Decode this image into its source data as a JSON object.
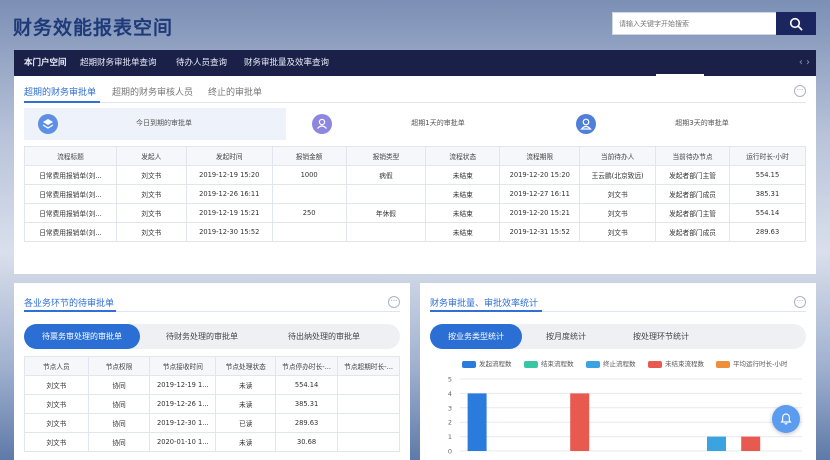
{
  "header": {
    "logo": "财务效能报表空间",
    "search_placeholder": "请输入关键字开始搜索",
    "search_icon": "search-icon"
  },
  "nav": {
    "items": [
      "本门户空间",
      "超期财务审批单查询",
      "待办人员查询",
      "财务审批量及效率查询"
    ],
    "active": 0,
    "arrows": "‹  ›"
  },
  "top": {
    "tabs": [
      "超期的财务审批单",
      "超期的财务审核人员",
      "终止的审批单"
    ],
    "active_tab": 0,
    "more": "···",
    "cards": [
      {
        "icon": "layers-icon",
        "label": "今日到期的审批单"
      },
      {
        "icon": "user-group-icon",
        "label": "超期1天的审批单"
      },
      {
        "icon": "user-icon",
        "label": "超期3天的审批单"
      }
    ],
    "table": {
      "headers": [
        "流程标题",
        "发起人",
        "发起时间",
        "报销金额",
        "报销类型",
        "流程状态",
        "流程期限",
        "当前待办人",
        "当前待办节点",
        "运行时长-小时"
      ],
      "rows": [
        [
          "日常费用报销单(刘...",
          "刘文书",
          "2019-12-19 15:20",
          "1000",
          "病假",
          "未结束",
          "2019-12-20 15:20",
          "王云鹏(北京致远)",
          "发起者部门主管",
          "554.15"
        ],
        [
          "日常费用报销单(刘...",
          "刘文书",
          "2019-12-26 16:11",
          "",
          "",
          "未结束",
          "2019-12-27 16:11",
          "刘文书",
          "发起者部门成员",
          "385.31"
        ],
        [
          "日常费用报销单(刘...",
          "刘文书",
          "2019-12-19 15:21",
          "250",
          "年休假",
          "未结束",
          "2019-12-20 15:21",
          "刘文书",
          "发起者部门主管",
          "554.14"
        ],
        [
          "日常费用报销单(刘...",
          "刘文书",
          "2019-12-30 15:52",
          "",
          "",
          "未结束",
          "2019-12-31 15:52",
          "刘文书",
          "发起者部门成员",
          "289.63"
        ]
      ]
    }
  },
  "left": {
    "title": "各业务环节的待审批单",
    "more": "···",
    "pills": [
      "待票务审处理的审批单",
      "待财务处理的审批单",
      "待出纳处理的审批单"
    ],
    "active_pill": 0,
    "table": {
      "headers": [
        "节点人员",
        "节点权限",
        "节点接收时间",
        "节点处理状态",
        "节点停办时长-...",
        "节点超期时长-..."
      ],
      "rows": [
        [
          "刘文书",
          "协同",
          "2019-12-19 1...",
          "未读",
          "554.14",
          ""
        ],
        [
          "刘文书",
          "协同",
          "2019-12-26 1...",
          "未读",
          "385.31",
          ""
        ],
        [
          "刘文书",
          "协同",
          "2019-12-30 1...",
          "已读",
          "289.63",
          ""
        ],
        [
          "刘文书",
          "协同",
          "2020-01-10 1...",
          "未读",
          "30.68",
          ""
        ]
      ]
    }
  },
  "right": {
    "title": "财务审批量、审批效率统计",
    "more": "···",
    "pills": [
      "按业务类型统计",
      "按月度统计",
      "按处理环节统计"
    ],
    "active_pill": 0,
    "bell_icon": "bell-icon"
  },
  "chart_data": {
    "type": "bar",
    "series": [
      {
        "name": "发起流程数",
        "color": "#2b7bdc",
        "values": [
          4,
          0
        ]
      },
      {
        "name": "结束流程数",
        "color": "#39c6a4",
        "values": [
          0,
          0
        ]
      },
      {
        "name": "终止流程数",
        "color": "#3aa3e0",
        "values": [
          0,
          1
        ]
      },
      {
        "name": "未结束流程数",
        "color": "#e85a4f",
        "values": [
          4,
          1
        ]
      },
      {
        "name": "平均运行时长-小时",
        "color": "#ef8e3a",
        "values": [
          0,
          0
        ]
      }
    ],
    "y_ticks": [
      "0",
      "1",
      "2",
      "3",
      "4",
      "5"
    ],
    "ylim": [
      0,
      5
    ],
    "legend": "top"
  }
}
